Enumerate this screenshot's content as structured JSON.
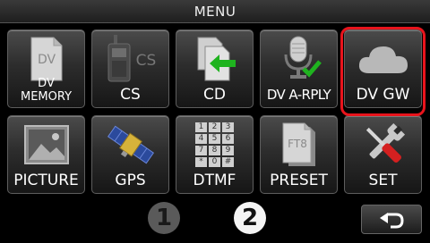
{
  "header": {
    "title": "MENU"
  },
  "tiles": [
    {
      "label_line1": "DV",
      "label_line2": "MEMORY",
      "icon": "dv-document-icon",
      "icon_text": "DV"
    },
    {
      "label": "CS",
      "icon": "radio-cs-icon",
      "icon_text": "CS"
    },
    {
      "label": "CD",
      "icon": "copy-documents-icon"
    },
    {
      "label": "DV A-RPLY",
      "icon": "microphone-check-icon"
    },
    {
      "label": "DV GW",
      "icon": "cloud-icon"
    },
    {
      "label": "PICTURE",
      "icon": "picture-icon"
    },
    {
      "label": "GPS",
      "icon": "satellite-icon"
    },
    {
      "label": "DTMF",
      "icon": "keypad-icon",
      "keys": [
        "1",
        "2",
        "3",
        "4",
        "5",
        "6",
        "7",
        "8",
        "9",
        "*",
        "0",
        "#"
      ]
    },
    {
      "label": "PRESET",
      "icon": "ft8-document-icon",
      "icon_text": "FT8"
    },
    {
      "label": "SET",
      "icon": "tools-icon"
    }
  ],
  "highlight": {
    "color": "#e8141c"
  },
  "pager": {
    "page1": "1",
    "page2": "2"
  },
  "back_button": {
    "icon": "return-arrow-icon"
  }
}
